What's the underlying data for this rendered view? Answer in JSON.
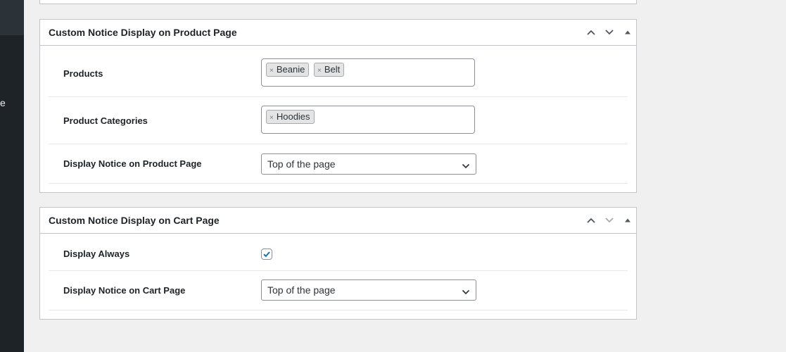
{
  "sidebar": {
    "partial_label": "e"
  },
  "product_box": {
    "title": "Custom Notice Display on Product Page",
    "products": {
      "label": "Products",
      "tokens": [
        {
          "text": "Beanie",
          "remove": "×"
        },
        {
          "text": "Belt",
          "remove": "×"
        }
      ]
    },
    "categories": {
      "label": "Product Categories",
      "tokens": [
        {
          "text": "Hoodies",
          "remove": "×"
        }
      ]
    },
    "position": {
      "label": "Display Notice on Product Page",
      "value": "Top of the page"
    }
  },
  "cart_box": {
    "title": "Custom Notice Display on Cart Page",
    "display_always": {
      "label": "Display Always",
      "checked": true
    },
    "position": {
      "label": "Display Notice on Cart Page",
      "value": "Top of the page"
    }
  },
  "icons": {
    "move_up": "chevron-up-icon",
    "move_down": "chevron-down-icon",
    "toggle": "triangle-up-icon"
  },
  "colors": {
    "sidebar": "#1d2327",
    "background": "#f0f0f1",
    "border": "#c3c4c7",
    "accent": "#2271b1"
  }
}
